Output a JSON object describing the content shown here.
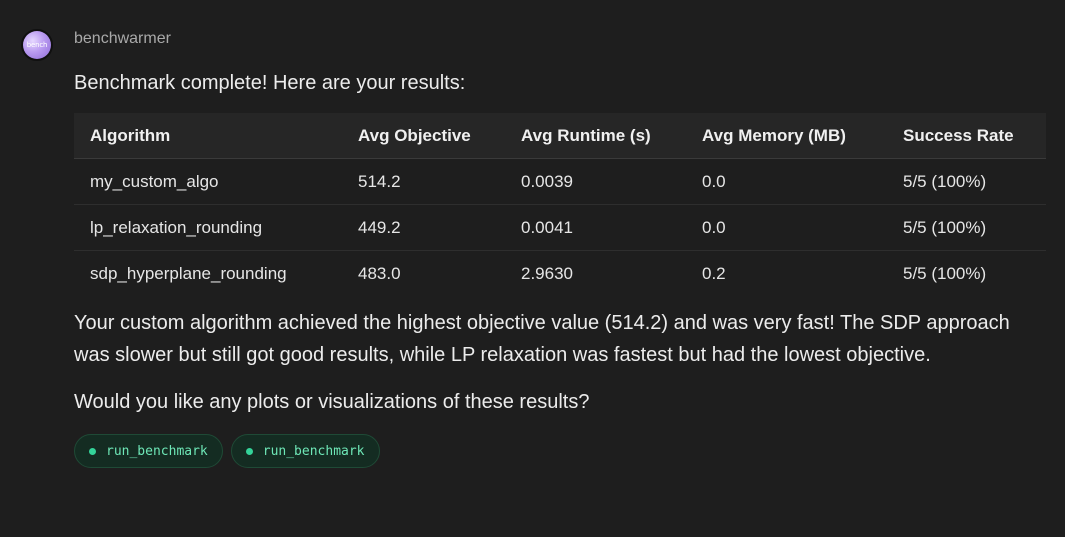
{
  "message": {
    "avatar_text": "bench",
    "author": "benchwarmer",
    "intro": "Benchmark complete! Here are your results:",
    "table": {
      "headers": [
        "Algorithm",
        "Avg Objective",
        "Avg Runtime (s)",
        "Avg Memory (MB)",
        "Success Rate"
      ],
      "rows": [
        [
          "my_custom_algo",
          "514.2",
          "0.0039",
          "0.0",
          "5/5 (100%)"
        ],
        [
          "lp_relaxation_rounding",
          "449.2",
          "0.0041",
          "0.0",
          "5/5 (100%)"
        ],
        [
          "sdp_hyperplane_rounding",
          "483.0",
          "2.9630",
          "0.2",
          "5/5 (100%)"
        ]
      ]
    },
    "summary": "Your custom algorithm achieved the highest objective value (514.2) and was very fast! The SDP approach was slower but still got good results, while LP relaxation was fastest but had the lowest objective.",
    "question": "Would you like any plots or visualizations of these results?",
    "tool_calls": [
      {
        "label": "run_benchmark",
        "status": "success"
      },
      {
        "label": "run_benchmark",
        "status": "success"
      }
    ]
  },
  "colors": {
    "background": "#1e1e1e",
    "table_header": "#262626",
    "tool_chip_bg": "#142c22",
    "tool_dot": "#34d399",
    "tool_text": "#6ee7b7"
  },
  "icons": {
    "avatar": "purple-gradient-circle",
    "tool_status": "green-dot-icon"
  }
}
